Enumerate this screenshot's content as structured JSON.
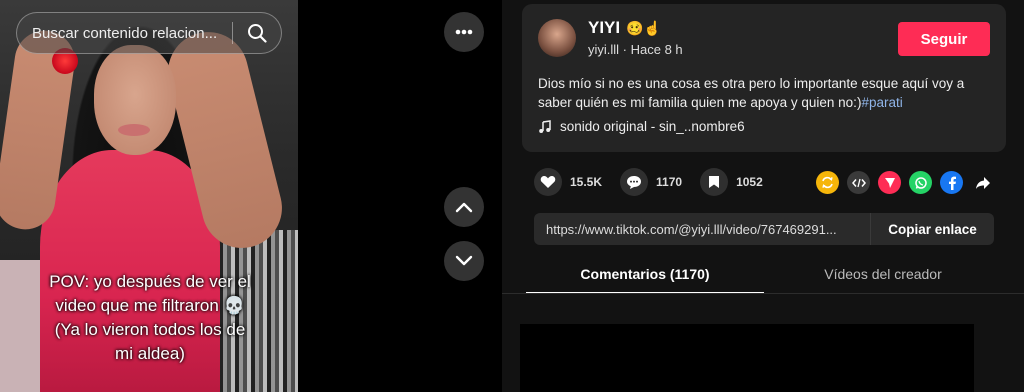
{
  "search": {
    "placeholder": "Buscar contenido relacion..."
  },
  "video": {
    "caption_lines": [
      "POV: yo después de ver el",
      "video que me filtraron 💀",
      "(Ya lo vieron todos los de",
      "mi aldea)"
    ]
  },
  "controls": {
    "more_icon": "ellipsis-icon",
    "prev_icon": "chevron-up-icon",
    "next_icon": "chevron-down-icon"
  },
  "author": {
    "name": "YIYI",
    "name_emojis": "🥴☝",
    "meta": "yiyi.lll · Hace 8 h",
    "follow_label": "Seguir",
    "description": "Dios mío si no es una cosa es otra pero lo importante esque aquí voy a saber quién es mi familia quien me apoya y quien no:)",
    "hashtag": "#parati",
    "music": "sonido original - sin_..nombre6"
  },
  "stats": {
    "likes": "15.5K",
    "comments": "1170",
    "saves": "1052"
  },
  "share_icons": [
    "repost-icon",
    "embed-icon",
    "send-icon",
    "whatsapp-icon",
    "facebook-icon",
    "forward-icon"
  ],
  "share_colors": {
    "repost": "#f6b60a",
    "embed": "#3a3a3a",
    "send": "#fe2c55",
    "whatsapp": "#25d366",
    "facebook": "#1877f2"
  },
  "link": {
    "url": "https://www.tiktok.com/@yiyi.lll/video/767469291...",
    "copy_label": "Copiar enlace"
  },
  "tabs": [
    {
      "label": "Comentarios (1170)",
      "active": true
    },
    {
      "label": "Vídeos del creador",
      "active": false
    }
  ],
  "colors": {
    "accent": "#fe2c55",
    "hashtag": "#8fb4e8"
  }
}
